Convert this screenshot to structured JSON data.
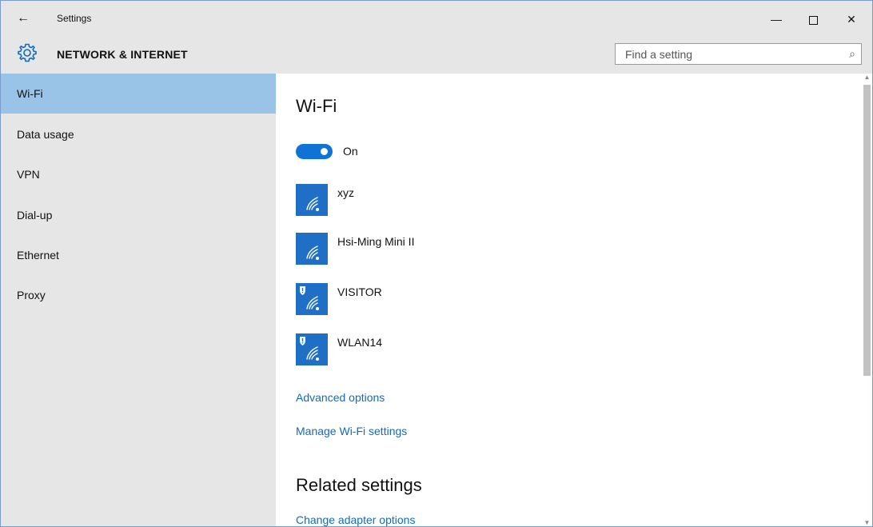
{
  "window": {
    "title": "Settings",
    "back_icon": "←",
    "minimize_icon": "—",
    "close_icon": "✕"
  },
  "header": {
    "section_title": "NETWORK & INTERNET",
    "search_placeholder": "Find a setting",
    "search_icon": "⌕"
  },
  "sidebar": {
    "items": [
      {
        "label": "Wi-Fi",
        "selected": true
      },
      {
        "label": "Data usage"
      },
      {
        "label": "VPN"
      },
      {
        "label": "Dial-up"
      },
      {
        "label": "Ethernet"
      },
      {
        "label": "Proxy"
      }
    ]
  },
  "main": {
    "heading": "Wi-Fi",
    "toggle": {
      "label": "On",
      "state": true
    },
    "networks": [
      {
        "name": "xyz",
        "secured": false
      },
      {
        "name": "Hsi-Ming Mini II",
        "secured": false
      },
      {
        "name": "VISITOR",
        "secured": true
      },
      {
        "name": "WLAN14",
        "secured": true
      }
    ],
    "links": {
      "advanced": "Advanced options",
      "manage": "Manage Wi-Fi settings"
    },
    "related_heading": "Related settings",
    "related_links": {
      "adapter": "Change adapter options"
    }
  },
  "scrollbar": {
    "up_arrow": "▲",
    "down_arrow": "▼"
  },
  "colors": {
    "accent": "#0f73d6",
    "link": "#0f6cbd",
    "selected_nav": "#99c4e8",
    "chrome": "#e6e6e6",
    "network_tile": "#1f6fc7"
  }
}
